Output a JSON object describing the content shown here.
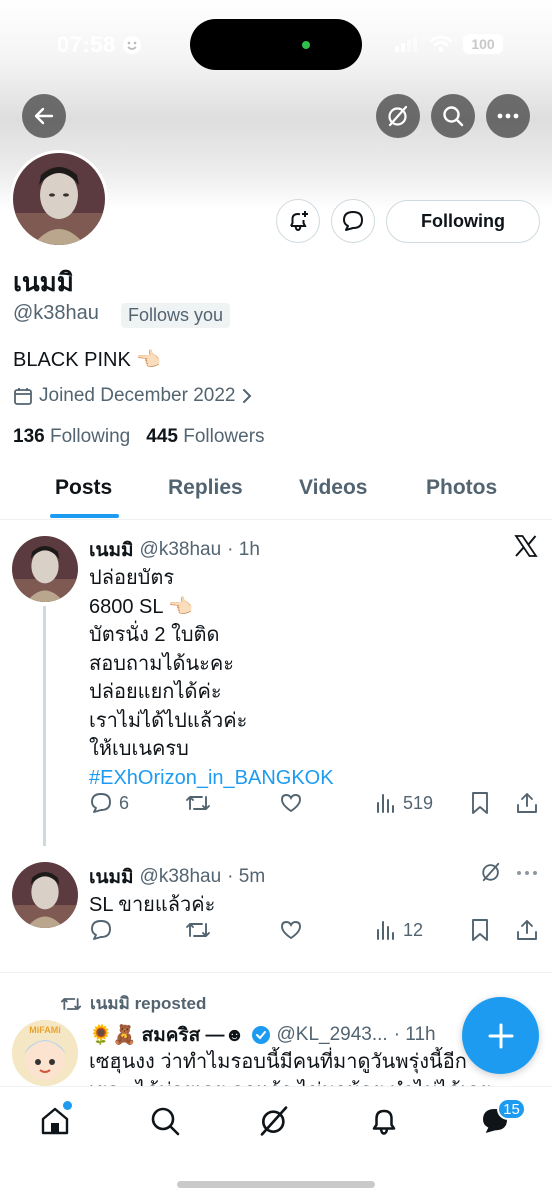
{
  "status_bar": {
    "time": "07:58",
    "battery": "100"
  },
  "profile": {
    "name": "เนมมิ",
    "handle": "@k38hau",
    "follows_you": "Follows you",
    "bio": "BLACK PINK 👈🏻",
    "joined": "Joined December 2022",
    "following_count": "136",
    "following_label": "Following",
    "followers_count": "445",
    "followers_label": "Followers",
    "follow_button": "Following"
  },
  "tabs": [
    "Posts",
    "Replies",
    "Videos",
    "Photos"
  ],
  "posts": [
    {
      "name": "เนมมิ",
      "handle": "@k38hau",
      "time": "· 1h",
      "lines": [
        "ปล่อยบัตร",
        "6800 SL 👈🏻",
        "บัตรนั่ง 2 ใบติด",
        "สอบถามได้นะคะ",
        "ปล่อยแยกได้ค่ะ",
        "เราไม่ได้ไปแล้วค่ะ",
        "ให้เบเนครบ"
      ],
      "hashtag": "#EXhOrizon_in_BANGKOK",
      "replies": "6",
      "views": "519"
    },
    {
      "name": "เนมมิ",
      "handle": "@k38hau",
      "time": "· 5m",
      "text": "SL ขายแล้วค่ะ",
      "views": "12"
    }
  ],
  "repost": {
    "reposted_label": "เนมมิ reposted",
    "name": "🌻🧸 สมคริส —☻",
    "handle": "@KL_2943...",
    "time": "· 11h",
    "text_line1": "เซฮุนงง ว่าทำไมรอบนี้มีคนที่มาดูวันพรุ่งนี้อีก",
    "text_line2": "เยอะ ได้บ่อยเลย ลูกแก้ว ไข่มุกน้อย ทำไม่ได้เลย",
    "avatar_text": "MiFAMi"
  },
  "nav": {
    "messages_badge": "15"
  },
  "colors": {
    "accent": "#1d9bf0",
    "text": "#0f1419",
    "secondary": "#536471"
  }
}
